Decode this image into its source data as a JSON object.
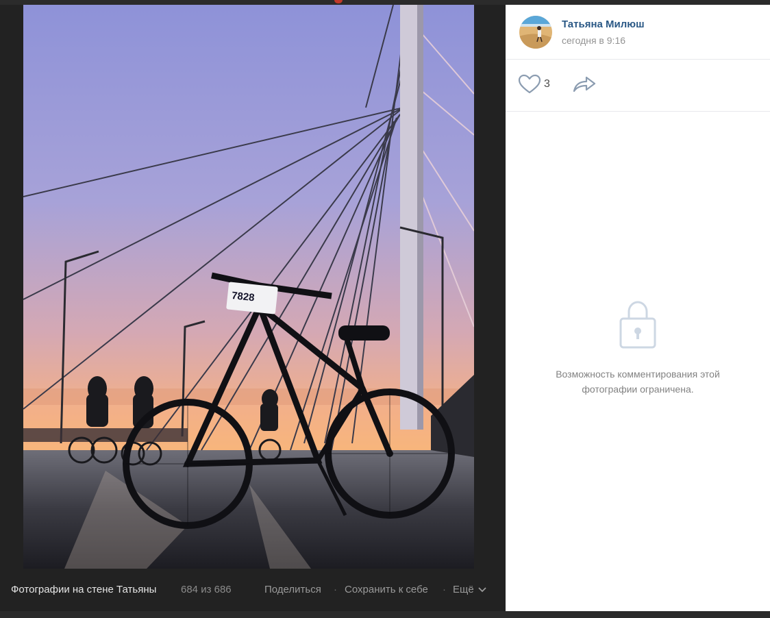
{
  "post": {
    "author": "Татьяна Милюш",
    "date": "сегодня в 9:16"
  },
  "actions": {
    "like_count": "3"
  },
  "comments": {
    "restricted_text": "Возможность комментирования этой фотографии ограничена."
  },
  "photo": {
    "bib_number": "7828"
  },
  "bottom_bar": {
    "album_title": "Фотографии на стене Татьяны",
    "counter": "684 из 686",
    "share_label": "Поделиться",
    "separator": "·",
    "save_label": "Сохранить к себе",
    "more_label": "Ещё"
  },
  "icons": {
    "like": "heart-icon",
    "share": "share-arrow-icon",
    "lock": "lock-icon",
    "more": "chevron-down-icon"
  },
  "colors": {
    "viewer_background": "#222222",
    "panel_background": "#ffffff",
    "author_link": "#2a5885",
    "muted_text": "#939393",
    "icon_gray": "#8b9cb0"
  }
}
